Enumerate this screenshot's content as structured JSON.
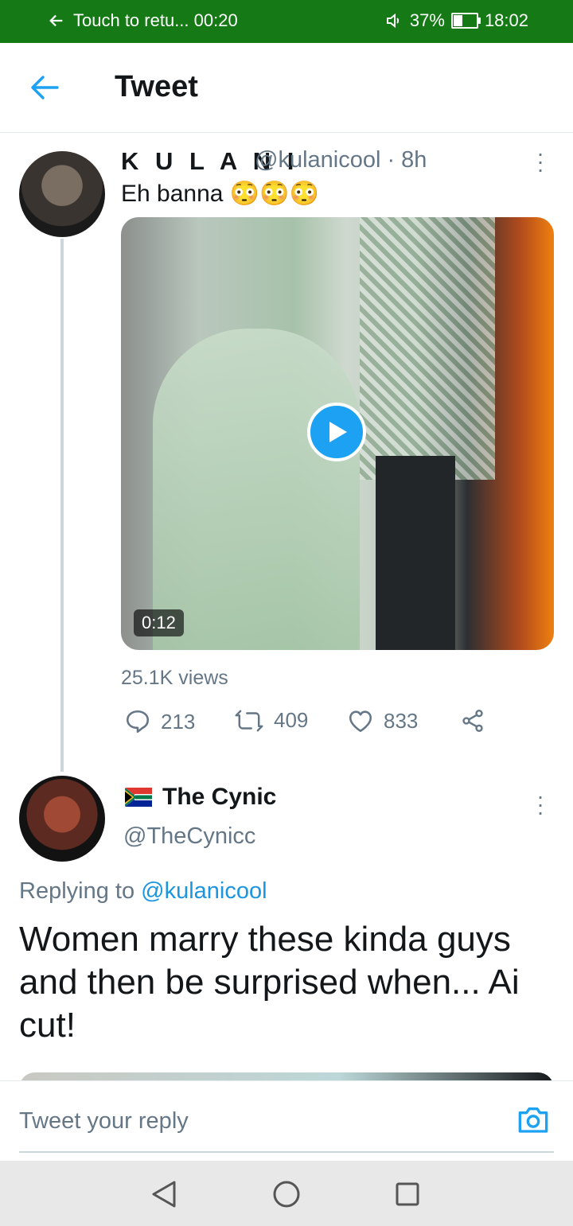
{
  "status_bar": {
    "return_text": "Touch to retu... 00:20",
    "battery_percent": "37%",
    "battery_level": 0.37,
    "time": "18:02"
  },
  "header": {
    "title": "Tweet"
  },
  "tweet": {
    "display_name": "K U L A N I",
    "handle_time": "@kulanicool · 8h",
    "text": "Eh banna 😳😳😳",
    "media": {
      "duration": "0:12"
    },
    "views": "25.1K views",
    "replies": "213",
    "retweets": "409",
    "likes": "833"
  },
  "reply": {
    "display_name": "The Cynic",
    "handle": "@TheCynicc",
    "replying_prefix": "Replying to ",
    "replying_to": "@kulanicool",
    "text": "Women marry these kinda guys and then be surprised when... Ai cut!"
  },
  "compose": {
    "placeholder": "Tweet your reply"
  },
  "colors": {
    "accent": "#1da1f2",
    "status_bar": "#157a16",
    "secondary_text": "#657786"
  }
}
